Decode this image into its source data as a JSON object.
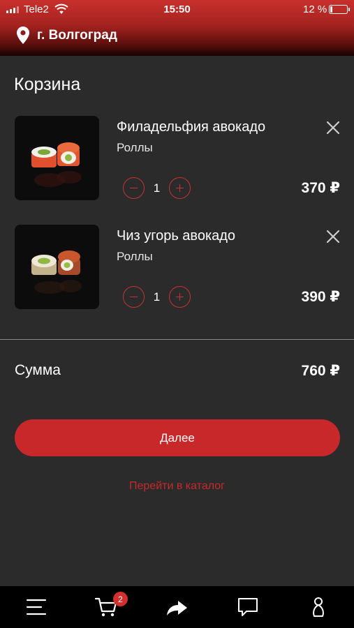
{
  "status_bar": {
    "carrier": "Tele2",
    "time": "15:50",
    "battery_percent": "12 %",
    "battery_level": 0.12
  },
  "header": {
    "city": "г. Волгоград",
    "icon": "location-pin-icon"
  },
  "page": {
    "title": "Корзина"
  },
  "cart": {
    "items": [
      {
        "name": "Филадельфия авокадо",
        "category": "Роллы",
        "quantity": "1",
        "price": "370 ₽"
      },
      {
        "name": "Чиз угорь авокадо",
        "category": "Роллы",
        "quantity": "1",
        "price": "390 ₽"
      }
    ],
    "sum_label": "Сумма",
    "sum_value": "760 ₽"
  },
  "actions": {
    "next_label": "Далее",
    "catalog_label": "Перейти в каталог"
  },
  "tabbar": {
    "cart_badge": "2",
    "icons": [
      "menu-icon",
      "cart-icon",
      "share-icon",
      "chat-icon",
      "profile-icon"
    ]
  },
  "colors": {
    "accent": "#c8282a",
    "background": "#2b2b2b",
    "header_gradient_top": "#c9302c",
    "tabbar": "#000000"
  }
}
